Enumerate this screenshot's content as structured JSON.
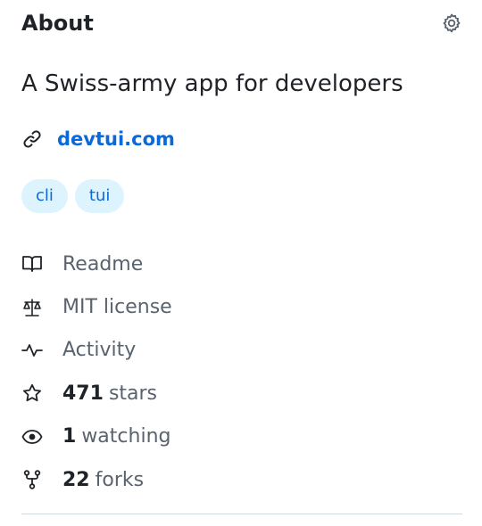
{
  "about": {
    "title": "About",
    "description": "A Swiss-army app for developers",
    "website": "devtui.com",
    "topics": [
      "cli",
      "tui"
    ]
  },
  "meta": {
    "readme": "Readme",
    "license": "MIT license",
    "activity": "Activity",
    "stars_count": "471",
    "stars_label": "stars",
    "watching_count": "1",
    "watching_label": "watching",
    "forks_count": "22",
    "forks_label": "forks"
  },
  "colors": {
    "link": "#0969da",
    "topic_bg": "#ddf4ff",
    "text": "#1f2328",
    "muted": "#59636e"
  }
}
